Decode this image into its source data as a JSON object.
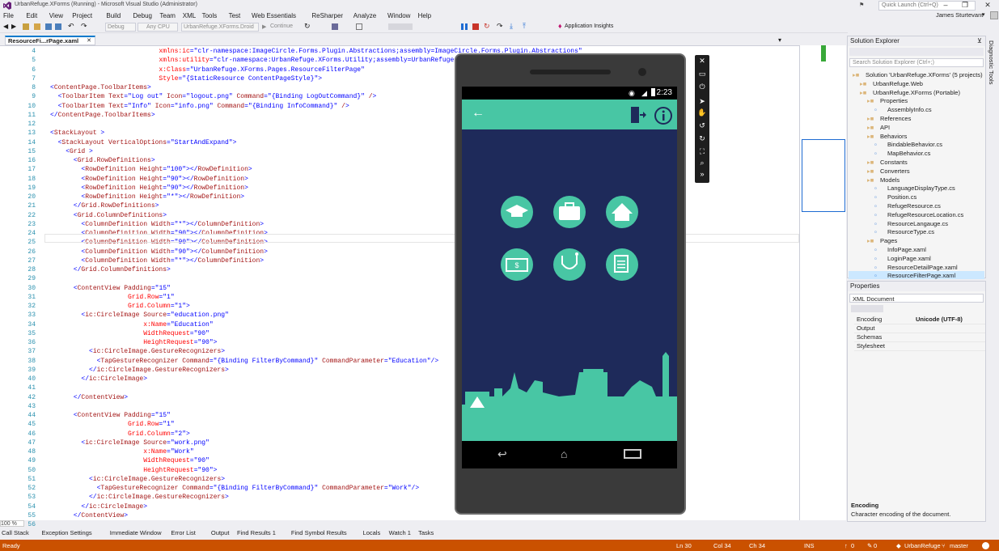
{
  "window": {
    "title": "UrbanRefuge.XForms (Running) - Microsoft Visual Studio (Administrator)",
    "quick_launch_placeholder": "Quick Launch (Ctrl+Q)",
    "user": "James Sturtevant"
  },
  "menu": [
    "File",
    "Edit",
    "View",
    "Project",
    "Build",
    "Debug",
    "Team",
    "XML",
    "Tools",
    "Test",
    "Web Essentials",
    "ReSharper",
    "Analyze",
    "Window",
    "Help"
  ],
  "toolbar": {
    "config": "Debug",
    "platform": "Any CPU",
    "startup": "UrbanRefuge.XForms.Droid",
    "continue": "Continue",
    "app_insights": "Application Insights"
  },
  "doc_tab": "ResourceFi...rPage.xaml",
  "code_lines": [
    {
      "n": "4",
      "indent": 14,
      "text": "xmlns:ic=\"clr-namespace:ImageCircle.Forms.Plugin.Abstractions;assembly=ImageCircle.Forms.Plugin.Abstractions\""
    },
    {
      "n": "5",
      "indent": 14,
      "text": "xmlns:utility=\"clr-namespace:UrbanRefuge.XForms.Utility;assembly=UrbanRefuge.XForms\""
    },
    {
      "n": "6",
      "indent": 14,
      "text": "x:Class=\"UrbanRefuge.XForms.Pages.ResourceFilterPage\""
    },
    {
      "n": "7",
      "indent": 14,
      "text": "Style=\"{StaticResource ContentPageStyle}\">"
    },
    {
      "n": "8",
      "indent": 0,
      "text": "<ContentPage.ToolbarItems>"
    },
    {
      "n": "9",
      "indent": 1,
      "text": "<ToolbarItem Text=\"Log out\" Icon=\"logout.png\" Command=\"{Binding LogOutCommand}\" />"
    },
    {
      "n": "10",
      "indent": 1,
      "text": "<ToolbarItem Text=\"Info\" Icon=\"info.png\" Command=\"{Binding InfoCommand}\" />"
    },
    {
      "n": "11",
      "indent": 0,
      "text": "</ContentPage.ToolbarItems>"
    },
    {
      "n": "12",
      "indent": 0,
      "text": ""
    },
    {
      "n": "13",
      "indent": 0,
      "text": "<StackLayout >"
    },
    {
      "n": "14",
      "indent": 1,
      "text": "<StackLayout VerticalOptions=\"StartAndExpand\">"
    },
    {
      "n": "15",
      "indent": 2,
      "text": "<Grid >"
    },
    {
      "n": "16",
      "indent": 3,
      "text": "<Grid.RowDefinitions>"
    },
    {
      "n": "17",
      "indent": 4,
      "text": "<RowDefinition Height=\"100\"></RowDefinition>"
    },
    {
      "n": "18",
      "indent": 4,
      "text": "<RowDefinition Height=\"90\"></RowDefinition>"
    },
    {
      "n": "19",
      "indent": 4,
      "text": "<RowDefinition Height=\"90\"></RowDefinition>"
    },
    {
      "n": "20",
      "indent": 4,
      "text": "<RowDefinition Height=\"*\"></RowDefinition>"
    },
    {
      "n": "21",
      "indent": 3,
      "text": "</Grid.RowDefinitions>"
    },
    {
      "n": "22",
      "indent": 3,
      "text": "<Grid.ColumnDefinitions>"
    },
    {
      "n": "23",
      "indent": 4,
      "text": "<ColumnDefinition Width=\"*\"></ColumnDefinition>"
    },
    {
      "n": "24",
      "indent": 4,
      "text": "<ColumnDefinition Width=\"90\"></ColumnDefinition>"
    },
    {
      "n": "25",
      "indent": 4,
      "text": "<ColumnDefinition Width=\"90\"></ColumnDefinition>"
    },
    {
      "n": "26",
      "indent": 4,
      "text": "<ColumnDefinition Width=\"90\"></ColumnDefinition>"
    },
    {
      "n": "27",
      "indent": 4,
      "text": "<ColumnDefinition Width=\"*\"></ColumnDefinition>"
    },
    {
      "n": "28",
      "indent": 3,
      "text": "</Grid.ColumnDefinitions>"
    },
    {
      "n": "29",
      "indent": 0,
      "text": ""
    },
    {
      "n": "30",
      "indent": 3,
      "text": "<ContentView Padding=\"15\""
    },
    {
      "n": "31",
      "indent": 10,
      "text": "Grid.Row=\"1\""
    },
    {
      "n": "32",
      "indent": 10,
      "text": "Grid.Column=\"1\">"
    },
    {
      "n": "33",
      "indent": 4,
      "text": "<ic:CircleImage Source=\"education.png\""
    },
    {
      "n": "34",
      "indent": 12,
      "text": "x:Name=\"Education\""
    },
    {
      "n": "35",
      "indent": 12,
      "text": "WidthRequest=\"90\""
    },
    {
      "n": "36",
      "indent": 12,
      "text": "HeightRequest=\"90\">"
    },
    {
      "n": "37",
      "indent": 5,
      "text": "<ic:CircleImage.GestureRecognizers>"
    },
    {
      "n": "38",
      "indent": 6,
      "text": "<TapGestureRecognizer Command=\"{Binding FilterByCommand}\" CommandParameter=\"Education\"/>"
    },
    {
      "n": "39",
      "indent": 5,
      "text": "</ic:CircleImage.GestureRecognizers>"
    },
    {
      "n": "40",
      "indent": 4,
      "text": "</ic:CircleImage>"
    },
    {
      "n": "41",
      "indent": 0,
      "text": ""
    },
    {
      "n": "42",
      "indent": 3,
      "text": "</ContentView>"
    },
    {
      "n": "43",
      "indent": 0,
      "text": ""
    },
    {
      "n": "44",
      "indent": 3,
      "text": "<ContentView Padding=\"15\""
    },
    {
      "n": "45",
      "indent": 10,
      "text": "Grid.Row=\"1\""
    },
    {
      "n": "46",
      "indent": 10,
      "text": "Grid.Column=\"2\">"
    },
    {
      "n": "47",
      "indent": 4,
      "text": "<ic:CircleImage Source=\"work.png\""
    },
    {
      "n": "48",
      "indent": 12,
      "text": "x:Name=\"Work\""
    },
    {
      "n": "49",
      "indent": 12,
      "text": "WidthRequest=\"90\""
    },
    {
      "n": "50",
      "indent": 12,
      "text": "HeightRequest=\"90\">"
    },
    {
      "n": "51",
      "indent": 5,
      "text": "<ic:CircleImage.GestureRecognizers>"
    },
    {
      "n": "52",
      "indent": 6,
      "text": "<TapGestureRecognizer Command=\"{Binding FilterByCommand}\" CommandParameter=\"Work\"/>"
    },
    {
      "n": "53",
      "indent": 5,
      "text": "</ic:CircleImage.GestureRecognizers>"
    },
    {
      "n": "54",
      "indent": 4,
      "text": "</ic:CircleImage>"
    },
    {
      "n": "55",
      "indent": 3,
      "text": "</ContentView>"
    },
    {
      "n": "56",
      "indent": 0,
      "text": ""
    }
  ],
  "zoom": "100 %",
  "phone": {
    "time": "2:23",
    "accent": "#48c6a4",
    "background": "#1e2a5a"
  },
  "solution_explorer": {
    "title": "Solution Explorer",
    "search_placeholder": "Search Solution Explorer (Ctrl+;)",
    "items": [
      {
        "label": "Solution 'UrbanRefuge.XForms' (5 projects)",
        "depth": 0
      },
      {
        "label": "UrbanRefuge.Web",
        "depth": 1
      },
      {
        "label": "UrbanRefuge.XForms (Portable)",
        "depth": 1
      },
      {
        "label": "Properties",
        "depth": 2
      },
      {
        "label": "AssemblyInfo.cs",
        "depth": 3
      },
      {
        "label": "References",
        "depth": 2
      },
      {
        "label": "API",
        "depth": 2
      },
      {
        "label": "Behaviors",
        "depth": 2
      },
      {
        "label": "BindableBehavior.cs",
        "depth": 3
      },
      {
        "label": "MapBehavior.cs",
        "depth": 3
      },
      {
        "label": "Constants",
        "depth": 2
      },
      {
        "label": "Converters",
        "depth": 2
      },
      {
        "label": "Models",
        "depth": 2
      },
      {
        "label": "LanguageDisplayType.cs",
        "depth": 3
      },
      {
        "label": "Position.cs",
        "depth": 3
      },
      {
        "label": "RefugeResource.cs",
        "depth": 3
      },
      {
        "label": "RefugeResourceLocation.cs",
        "depth": 3
      },
      {
        "label": "ResourceLangauge.cs",
        "depth": 3
      },
      {
        "label": "ResourceType.cs",
        "depth": 3
      },
      {
        "label": "Pages",
        "depth": 2
      },
      {
        "label": "InfoPage.xaml",
        "depth": 3
      },
      {
        "label": "LoginPage.xaml",
        "depth": 3
      },
      {
        "label": "ResourceDetailPage.xaml",
        "depth": 3
      },
      {
        "label": "ResourceFilterPage.xaml",
        "depth": 3
      }
    ]
  },
  "diagnostic_tools": "Diagnostic Tools",
  "properties": {
    "title": "Properties",
    "object": "XML Document",
    "rows": [
      {
        "name": "Encoding",
        "value": "Unicode (UTF-8)"
      },
      {
        "name": "Output",
        "value": ""
      },
      {
        "name": "Schemas",
        "value": ""
      },
      {
        "name": "Stylesheet",
        "value": ""
      }
    ],
    "desc_title": "Encoding",
    "desc_text": "Character encoding of the document."
  },
  "tool_tabs": [
    "Call Stack",
    "Exception Settings",
    "Immediate Window",
    "Error List",
    "Output",
    "Find Results 1",
    "Find Symbol Results",
    "Locals",
    "Watch 1",
    "Tasks"
  ],
  "status": {
    "left": "Ready",
    "ln": "Ln 30",
    "col": "Col 34",
    "ch": "Ch 34",
    "ins": "INS",
    "up": "0",
    "pencil": "0",
    "repo": "UrbanRefuge",
    "branch": "master"
  }
}
